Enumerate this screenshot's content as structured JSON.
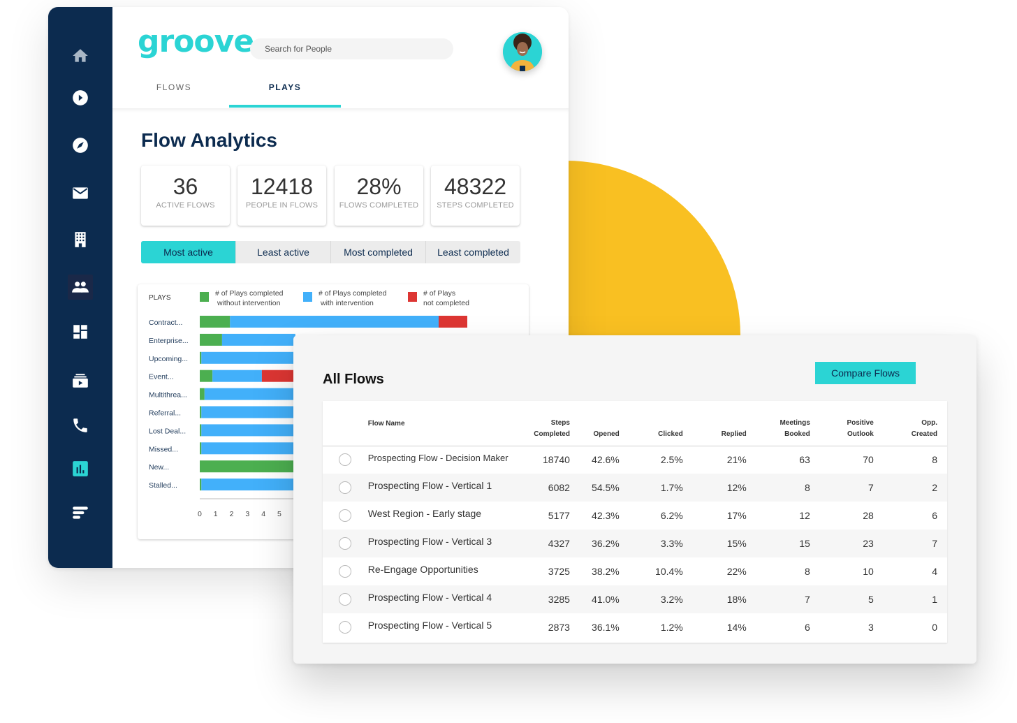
{
  "app": {
    "logo_text": "groove",
    "search": {
      "placeholder": "Search for People",
      "value": ""
    },
    "avatar_alt": "user-avatar"
  },
  "sidebar": {
    "items": [
      {
        "name": "home",
        "icon": "home-icon",
        "active": false
      },
      {
        "name": "play",
        "icon": "play-circle-icon",
        "active": false
      },
      {
        "name": "explore",
        "icon": "compass-icon",
        "active": false
      },
      {
        "name": "email",
        "icon": "envelope-icon",
        "active": false
      },
      {
        "name": "accounts",
        "icon": "building-icon",
        "active": false
      },
      {
        "name": "people",
        "icon": "people-icon",
        "active": false
      },
      {
        "name": "dashboard",
        "icon": "dashboard-icon",
        "active": false
      },
      {
        "name": "media",
        "icon": "video-library-icon",
        "active": false
      },
      {
        "name": "calls",
        "icon": "phone-icon",
        "active": false
      },
      {
        "name": "analytics",
        "icon": "bar-chart-icon",
        "active": true
      },
      {
        "name": "flows",
        "icon": "lines-icon",
        "active": false
      }
    ]
  },
  "tabs": [
    {
      "label": "FLOWS",
      "active": false
    },
    {
      "label": "PLAYS",
      "active": true
    }
  ],
  "analytics": {
    "title": "Flow Analytics",
    "stats": [
      {
        "value": "36",
        "label": "ACTIVE FLOWS"
      },
      {
        "value": "12418",
        "label": "PEOPLE IN FLOWS"
      },
      {
        "value": "28%",
        "label": "FLOWS COMPLETED"
      },
      {
        "value": "48322",
        "label": "STEPS COMPLETED"
      }
    ],
    "filters": [
      {
        "label": "Most active",
        "active": true
      },
      {
        "label": "Least active",
        "active": false
      },
      {
        "label": "Most completed",
        "active": false
      },
      {
        "label": "Least completed",
        "active": false
      }
    ]
  },
  "chart_data": {
    "type": "bar",
    "orientation": "horizontal",
    "stacked": true,
    "title": "PLAYS",
    "categories": [
      "Contract...",
      "Enterprise...",
      "Upcoming...",
      "Event...",
      "Multithrea...",
      "Referral...",
      "Lost Deal...",
      "Missed...",
      "New...",
      "Stalled..."
    ],
    "series": [
      {
        "name": "# of Plays completed without intervention",
        "color": "#4caf50",
        "values": [
          1.9,
          1.4,
          0.1,
          0.8,
          0.3,
          0.1,
          0.1,
          0.1,
          6.0,
          0.1
        ]
      },
      {
        "name": "# of Plays completed with intervention",
        "color": "#42b0fa",
        "values": [
          13.1,
          4.6,
          5.9,
          3.1,
          5.7,
          5.9,
          5.9,
          5.9,
          0.0,
          5.9
        ]
      },
      {
        "name": "# of Plays not completed",
        "color": "#dd3633",
        "values": [
          1.8,
          0,
          0,
          2.1,
          0,
          0,
          0,
          0,
          0,
          0
        ]
      }
    ],
    "visible_x_max": 5.9,
    "xticks": [
      "0",
      "1",
      "2",
      "3",
      "4",
      "5"
    ],
    "xlim": [
      0,
      17
    ],
    "legend_position": "top",
    "note": "Bars beyond x≈5.9 are hidden behind the All Flows panel except the first row"
  },
  "all_flows": {
    "title": "All Flows",
    "compare_button": "Compare Flows",
    "columns": [
      "Flow Name",
      "Steps\nCompleted",
      "Opened",
      "Clicked",
      "Replied",
      "Meetings\nBooked",
      "Positive\nOutlook",
      "Opp.\nCreated"
    ],
    "column_lines": [
      [
        "Flow Name"
      ],
      [
        "Steps",
        "Completed"
      ],
      [
        "Opened"
      ],
      [
        "Clicked"
      ],
      [
        "Replied"
      ],
      [
        "Meetings",
        "Booked"
      ],
      [
        "Positive",
        "Outlook"
      ],
      [
        "Opp.",
        "Created"
      ]
    ],
    "rows": [
      {
        "name": "Prospecting Flow - Decision Maker",
        "steps": "18740",
        "opened": "42.6%",
        "clicked": "2.5%",
        "replied": "21%",
        "meetings": "63",
        "positive": "70",
        "opps": "8"
      },
      {
        "name": "Prospecting Flow - Vertical 1",
        "steps": "6082",
        "opened": "54.5%",
        "clicked": "1.7%",
        "replied": "12%",
        "meetings": "8",
        "positive": "7",
        "opps": "2"
      },
      {
        "name": "West Region - Early stage",
        "steps": "5177",
        "opened": "42.3%",
        "clicked": "6.2%",
        "replied": "17%",
        "meetings": "12",
        "positive": "28",
        "opps": "6"
      },
      {
        "name": "Prospecting Flow - Vertical 3",
        "steps": "4327",
        "opened": "36.2%",
        "clicked": "3.3%",
        "replied": "15%",
        "meetings": "15",
        "positive": "23",
        "opps": "7"
      },
      {
        "name": "Re-Engage Opportunities",
        "steps": "3725",
        "opened": "38.2%",
        "clicked": "10.4%",
        "replied": "22%",
        "meetings": "8",
        "positive": "10",
        "opps": "4"
      },
      {
        "name": "Prospecting Flow - Vertical 4",
        "steps": "3285",
        "opened": "41.0%",
        "clicked": "3.2%",
        "replied": "18%",
        "meetings": "7",
        "positive": "5",
        "opps": "1"
      },
      {
        "name": "Prospecting Flow - Vertical 5",
        "steps": "2873",
        "opened": "36.1%",
        "clicked": "1.2%",
        "replied": "14%",
        "meetings": "6",
        "positive": "3",
        "opps": "0"
      }
    ]
  },
  "colors": {
    "brand_teal": "#2bd4d4",
    "sidebar_navy": "#0c2b4f",
    "decor_yellow": "#f9c022"
  }
}
